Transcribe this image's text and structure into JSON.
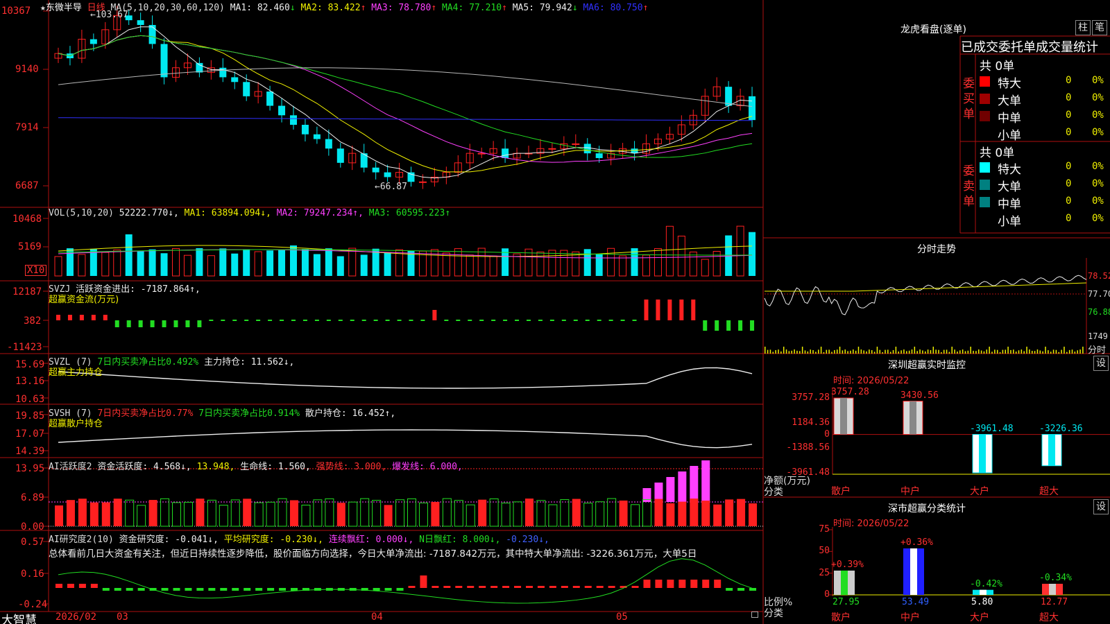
{
  "colors": {
    "up": "#ff2020",
    "down": "#00e8f0",
    "green": "#22dd22",
    "grid": "#b01010",
    "white": "#eeeeee",
    "yellow": "#f0f000",
    "magenta": "#ff40ff",
    "blue": "#3030ff",
    "gray": "#b8b8b8",
    "label": "#c0c0c0",
    "title": "#d0d0d0"
  },
  "main": {
    "star": "★",
    "stock_name": "东微半导",
    "period": "日线",
    "ma_param": "MA(5,10,20,30,60,120)",
    "ma": [
      {
        "label": "MA1: 82.460",
        "arrow": "↓",
        "color": "#eeeeee"
      },
      {
        "label": "MA2: 83.422",
        "arrow": "↑",
        "color": "#f0f000"
      },
      {
        "label": "MA3: 78.780",
        "arrow": "↑",
        "color": "#ff40ff"
      },
      {
        "label": "MA4: 77.210",
        "arrow": "↑",
        "color": "#22dd22"
      },
      {
        "label": "MA5: 79.942",
        "arrow": "↓",
        "color": "#eeeeee"
      },
      {
        "label": "MA6: 80.750",
        "arrow": "↑",
        "color": "#3030ff"
      }
    ],
    "y_labels": [
      "10367",
      "9140",
      "7914",
      "6687"
    ],
    "high_marker": "103.67",
    "low_marker": "66.87"
  },
  "vol": {
    "title": "VOL(5,10,20)",
    "value": "52222.770↓,",
    "ma1": "MA1: 63894.094↓,",
    "ma2": "MA2: 79247.234↑,",
    "ma3": "MA3: 60595.223↑",
    "y_labels": [
      "10468",
      "5169"
    ],
    "unit": "X10"
  },
  "svzj": {
    "name": "SVZJ",
    "label": "活跃资金进出: -7187.864↑,",
    "sub": "超赢资金流(万元)",
    "y_labels": [
      "12187",
      "382",
      "-11423"
    ]
  },
  "svzl": {
    "name": "SVZL (7)",
    "label1": "7日内买卖净占比0.492%",
    "label2": "主力持仓: 11.562↓,",
    "sub": "超赢主力持仓",
    "y_labels": [
      "15.69",
      "13.16",
      "10.63"
    ]
  },
  "svsh": {
    "name": "SVSH (7)",
    "label1": "7日内买卖净占比0.77%",
    "label2": "7日内买卖净占比0.914%",
    "label3": "散户持仓: 16.452↑,",
    "sub": "超赢散户持仓",
    "y_labels": [
      "19.85",
      "17.07",
      "14.39"
    ]
  },
  "ai_active": {
    "name": "AI活跃度2",
    "l1": "资金活跃度: 4.568↓,",
    "l2": "13.948,",
    "l3": "生命线: 1.560,",
    "l4": "强势线: 3.000,",
    "l5": "爆发线: 6.000,",
    "y_labels": [
      "13.95",
      "6.89",
      "0.00"
    ]
  },
  "ai_research": {
    "name": "AI研究度2(10)",
    "l1": "资金研究度: -0.041↓,",
    "l2": "平均研究度: -0.230↓,",
    "l3": "连续飘红: 0.000↓,",
    "l4": "N日飘红: 8.000↓,",
    "l5": "-0.230↓,",
    "summary": "总体看前几日大资金有关注，但近日持续性逐步降低，股价面临方向选择，今日大单净流出: -7187.842万元，其中特大单净流出: -3226.361万元，大单5日",
    "y_labels": [
      "0.57",
      "0.16",
      "-0.24"
    ]
  },
  "bottom": {
    "brand": "大智慧",
    "dates": [
      "2026/02",
      "03",
      "04",
      "05"
    ]
  },
  "dragon": {
    "title": "龙虎看盘(逐单)",
    "btn1": "柱",
    "btn2": "笔",
    "header": "已成交委托单成交量统计",
    "buy_label": "委买单",
    "sell_label": "委卖单",
    "buy_total": "共 0单",
    "sell_total": "共 0单",
    "buy_rows": [
      {
        "name": "特大",
        "count": "0",
        "pct": "0%",
        "color": "#ff0000"
      },
      {
        "name": "大单",
        "count": "0",
        "pct": "0%",
        "color": "#a00000"
      },
      {
        "name": "中单",
        "count": "0",
        "pct": "0%",
        "color": "#700000"
      },
      {
        "name": "小单",
        "count": "0",
        "pct": "0%",
        "color": ""
      }
    ],
    "sell_rows": [
      {
        "name": "特大",
        "count": "0",
        "pct": "0%",
        "color": "#00ffff"
      },
      {
        "name": "大单",
        "count": "0",
        "pct": "0%",
        "color": "#008080"
      },
      {
        "name": "中单",
        "count": "0",
        "pct": "0%",
        "color": "#008080"
      },
      {
        "name": "小单",
        "count": "0",
        "pct": "0%",
        "color": ""
      }
    ]
  },
  "intraday": {
    "title": "分时走势",
    "y_labels": [
      "78.52",
      "77.70",
      "76.88"
    ],
    "vol_label": "1749",
    "foot": "分时"
  },
  "sz_monitor": {
    "title": "深圳超赢实时监控",
    "btn": "设",
    "time": "时间: 2026/05/22",
    "y_labels": [
      "3757.28",
      "1184.36",
      "0",
      "-1388.56",
      "-3961.48"
    ],
    "side1": "净额(万元)",
    "side2": "分类",
    "categories": [
      "散户",
      "中户",
      "大户",
      "超大"
    ],
    "values": [
      3757.28,
      3430.56,
      -3961.48,
      -3226.36
    ],
    "value_labels": [
      "3757.28",
      "3430.56",
      "-3961.48",
      "-3226.36"
    ]
  },
  "sz_class": {
    "title": "深市超赢分类统计",
    "btn": "设",
    "time": "时间: 2026/05/22",
    "y_labels": [
      "75",
      "50",
      "25",
      "0"
    ],
    "side1": "比例%",
    "side2": "分类",
    "categories": [
      "散户",
      "中户",
      "大户",
      "超大"
    ],
    "values": [
      27.95,
      53.49,
      5.8,
      12.77
    ],
    "value_labels": [
      "27.95",
      "53.49",
      "5.80",
      "12.77"
    ],
    "changes": [
      "+0.39%",
      "+0.36%",
      "-0.42%",
      "-0.34%"
    ]
  }
}
